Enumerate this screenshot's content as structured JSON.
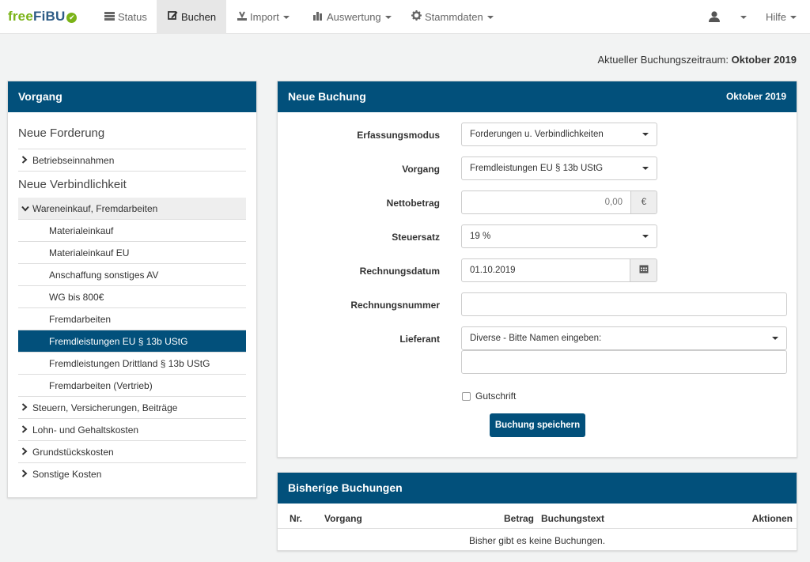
{
  "brand": {
    "part1": "free",
    "part2": "FiBU",
    "check": "✔"
  },
  "nav": {
    "status": "Status",
    "buchen": "Buchen",
    "import": "Import",
    "auswertung": "Auswertung",
    "stammdaten": "Stammdaten",
    "hilfe": "Hilfe"
  },
  "period": {
    "label": "Aktueller Buchungszeitraum:",
    "value": "Oktober 2019"
  },
  "vorgang": {
    "title": "Vorgang",
    "group_forderung": "Neue Forderung",
    "betriebseinnahmen": "Betriebseinnahmen",
    "group_verbindlichkeit": "Neue Verbindlichkeit",
    "wareneinkauf": "Wareneinkauf, Fremdarbeiten",
    "subs": [
      "Materialeinkauf",
      "Materialeinkauf EU",
      "Anschaffung sonstiges AV",
      "WG bis 800€",
      "Fremdarbeiten",
      "Fremdleistungen EU § 13b UStG",
      "Fremdleistungen Drittland § 13b UStG",
      "Fremdarbeiten (Vertrieb)"
    ],
    "cats": [
      "Steuern, Versicherungen, Beiträge",
      "Lohn- und Gehaltskosten",
      "Grundstückskosten",
      "Sonstige Kosten"
    ]
  },
  "form": {
    "title": "Neue Buchung",
    "period": "Oktober 2019",
    "erfassungsmodus_label": "Erfassungsmodus",
    "erfassungsmodus_value": "Forderungen u. Verbindlichkeiten",
    "vorgang_label": "Vorgang",
    "vorgang_value": "Fremdleistungen EU § 13b UStG",
    "netto_label": "Nettobetrag",
    "netto_value": "0,00",
    "currency": "€",
    "steuer_label": "Steuersatz",
    "steuer_value": "19 %",
    "datum_label": "Rechnungsdatum",
    "datum_value": "01.10.2019",
    "nummer_label": "Rechnungsnummer",
    "nummer_value": "",
    "lieferant_label": "Lieferant",
    "lieferant_value": "Diverse - Bitte Namen eingeben:",
    "lieferant_name_value": "",
    "gutschrift_label": "Gutschrift",
    "save_label": "Buchung speichern"
  },
  "bookings": {
    "title": "Bisherige Buchungen",
    "columns": [
      "Nr.",
      "Vorgang",
      "Betrag",
      "Buchungstext",
      "Aktionen"
    ],
    "empty": "Bisher gibt es keine Buchungen."
  }
}
